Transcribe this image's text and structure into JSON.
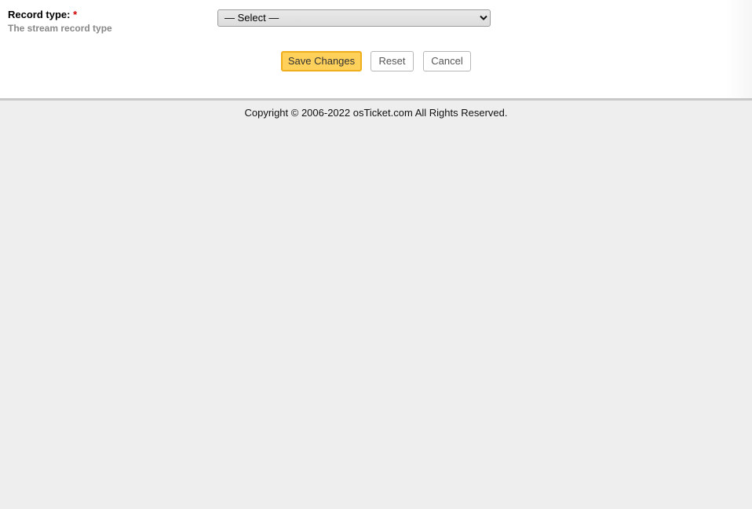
{
  "form": {
    "field": {
      "label": "Record type:",
      "required_marker": "*",
      "hint": "The stream record type"
    },
    "select": {
      "selected": "— Select —"
    },
    "buttons": {
      "save_label": "Save Changes",
      "reset_label": "Reset",
      "cancel_label": "Cancel"
    }
  },
  "footer": {
    "copyright": "Copyright © 2006-2022 osTicket.com All Rights Reserved."
  },
  "colors": {
    "save_button_bg": "#ffd05a",
    "save_button_border": "#f0ae1d",
    "required_marker": "#d00000",
    "page_bg": "#eeeeee"
  }
}
